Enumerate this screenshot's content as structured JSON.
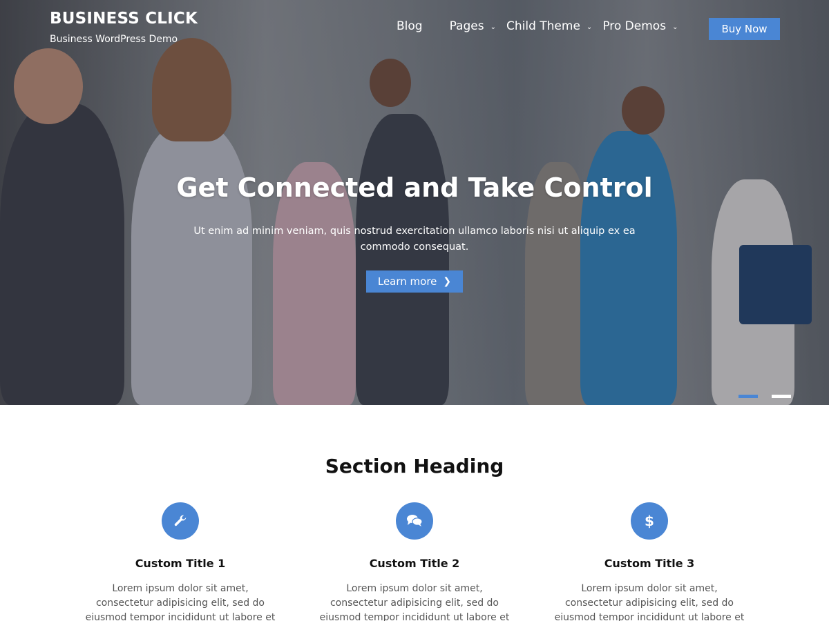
{
  "header": {
    "site_title": "BUSINESS CLICK",
    "tagline": "Business WordPress Demo",
    "nav": [
      {
        "label": "Blog",
        "has_dropdown": false
      },
      {
        "label": "Pages",
        "has_dropdown": true
      },
      {
        "label": "Child Theme",
        "has_dropdown": true
      },
      {
        "label": "Pro Demos",
        "has_dropdown": true
      }
    ],
    "buy_button": "Buy Now"
  },
  "hero": {
    "title": "Get Connected and Take Control",
    "text": "Ut enim ad minim veniam, quis nostrud exercitation ullamco laboris nisi ut aliquip ex ea commodo consequat.",
    "button": "Learn more",
    "slides": {
      "count": 2,
      "active": 1
    }
  },
  "features": {
    "heading": "Section Heading",
    "items": [
      {
        "icon": "wrench-icon",
        "title": "Custom Title 1",
        "text": "Lorem ipsum dolor sit amet, consectetur adipisicing elit, sed do eiusmod tempor incididunt ut labore et dolore magna"
      },
      {
        "icon": "chat-icon",
        "title": "Custom Title 2",
        "text": "Lorem ipsum dolor sit amet, consectetur adipisicing elit, sed do eiusmod tempor incididunt ut labore et dolore magna"
      },
      {
        "icon": "dollar-icon",
        "title": "Custom Title 3",
        "text": "Lorem ipsum dolor sit amet, consectetur adipisicing elit, sed do eiusmod tempor incididunt ut labore et dolore magna"
      }
    ]
  },
  "colors": {
    "accent": "#4a86d4",
    "dot_inactive": "#ffffff",
    "text_dark": "#111111",
    "text_body": "#555555"
  }
}
